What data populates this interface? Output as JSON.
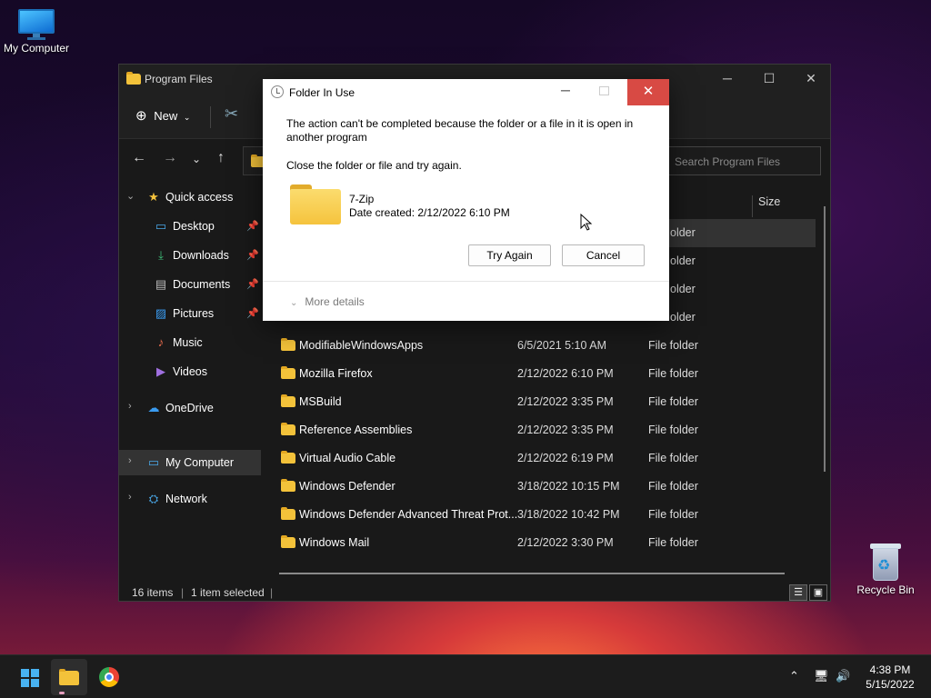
{
  "desktop": {
    "my_computer_label": "My Computer",
    "recycle_bin_label": "Recycle Bin"
  },
  "explorer": {
    "title": "Program Files",
    "toolbar": {
      "new_label": "New"
    },
    "search_placeholder": "Search Program Files",
    "column_size": "Size",
    "nav": {
      "quick_access": "Quick access",
      "desktop": "Desktop",
      "downloads": "Downloads",
      "documents": "Documents",
      "pictures": "Pictures",
      "music": "Music",
      "videos": "Videos",
      "onedrive": "OneDrive",
      "my_computer": "My Computer",
      "network": "Network"
    },
    "visible_types_behind_dialog": [
      "older",
      "older",
      "older",
      "older"
    ],
    "files": [
      {
        "name": "ModifiableWindowsApps",
        "date": "6/5/2021 5:10 AM",
        "type": "File folder"
      },
      {
        "name": "Mozilla Firefox",
        "date": "2/12/2022 6:10 PM",
        "type": "File folder"
      },
      {
        "name": "MSBuild",
        "date": "2/12/2022 3:35 PM",
        "type": "File folder"
      },
      {
        "name": "Reference Assemblies",
        "date": "2/12/2022 3:35 PM",
        "type": "File folder"
      },
      {
        "name": "Virtual Audio Cable",
        "date": "2/12/2022 6:19 PM",
        "type": "File folder"
      },
      {
        "name": "Windows Defender",
        "date": "3/18/2022 10:15 PM",
        "type": "File folder"
      },
      {
        "name": "Windows Defender Advanced Threat Prot...",
        "date": "3/18/2022 10:42 PM",
        "type": "File folder"
      },
      {
        "name": "Windows Mail",
        "date": "2/12/2022 3:30 PM",
        "type": "File folder"
      }
    ],
    "status": {
      "items": "16 items",
      "selected": "1 item selected"
    }
  },
  "dialog": {
    "title": "Folder In Use",
    "message": "The action can't be completed because the folder or a file in it is open in another program",
    "instruction": "Close the folder or file and try again.",
    "item_name": "7-Zip",
    "item_date": "Date created: 2/12/2022 6:10 PM",
    "try_again": "Try Again",
    "cancel": "Cancel",
    "more_details": "More details"
  },
  "taskbar": {
    "time": "4:38 PM",
    "date": "5/15/2022"
  },
  "colors": {
    "accent": "#48b2f1",
    "close_red": "#d84a44",
    "folder_yellow": "#f5c33d"
  }
}
